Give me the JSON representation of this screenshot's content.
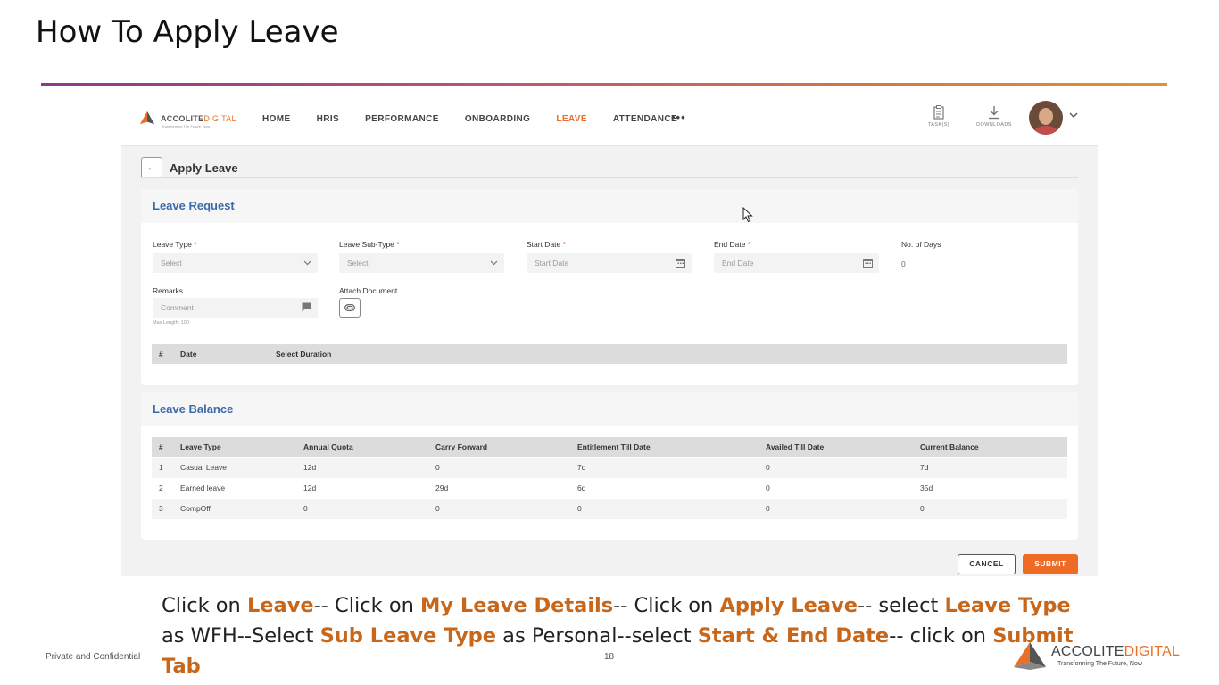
{
  "slide": {
    "title": "How To Apply Leave",
    "footer_left": "Private and Confidential",
    "page_number": "18"
  },
  "app": {
    "logo": {
      "name_left": "ACCOLITE",
      "name_right": "DIGITAL",
      "tagline": "Transforming The Future, Now"
    },
    "nav": [
      {
        "label": "HOME"
      },
      {
        "label": "HRIS"
      },
      {
        "label": "PERFORMANCE"
      },
      {
        "label": "ONBOARDING"
      },
      {
        "label": "LEAVE",
        "active": true
      },
      {
        "label": "ATTENDANCE"
      }
    ],
    "nav_more": "•••",
    "tools": {
      "tasks_label": "TASK(S)",
      "downloads_label": "DOWNLOADS"
    },
    "page_title": "Apply Leave",
    "leave_request": {
      "heading": "Leave Request",
      "leave_type": {
        "label": "Leave Type",
        "required": "*",
        "placeholder": "Select"
      },
      "leave_sub_type": {
        "label": "Leave Sub-Type",
        "required": "*",
        "placeholder": "Select"
      },
      "start_date": {
        "label": "Start Date",
        "required": "*",
        "placeholder": "Start Date"
      },
      "end_date": {
        "label": "End Date",
        "required": "*",
        "placeholder": "End Date"
      },
      "no_of_days": {
        "label": "No. of Days",
        "value": "0"
      },
      "remarks": {
        "label": "Remarks",
        "placeholder": "Comment",
        "hint": "Max Length: 100"
      },
      "attach": {
        "label": "Attach Document"
      },
      "table_headers": {
        "num": "#",
        "date": "Date",
        "duration": "Select Duration"
      }
    },
    "leave_balance": {
      "heading": "Leave Balance",
      "headers": [
        "#",
        "Leave Type",
        "Annual Quota",
        "Carry Forward",
        "Entitlement Till Date",
        "Availed Till Date",
        "Current Balance"
      ],
      "rows": [
        [
          "1",
          "Casual Leave",
          "12d",
          "0",
          "7d",
          "0",
          "7d"
        ],
        [
          "2",
          "Earned leave",
          "12d",
          "29d",
          "6d",
          "0",
          "35d"
        ],
        [
          "3",
          "CompOff",
          "0",
          "0",
          "0",
          "0",
          "0"
        ]
      ]
    },
    "buttons": {
      "cancel": "CANCEL",
      "submit": "SUBMIT"
    }
  },
  "instructions": {
    "p1": "Click on ",
    "h1": "Leave",
    "p2": "-- Click on ",
    "h2": "My Leave Details",
    "p3": "-- Click on ",
    "h3": "Apply Leave",
    "p4": "-- select ",
    "h4": "Leave Type",
    "p5": " as WFH--Select ",
    "h5": "Sub Leave Type",
    "p6": " as Personal--select ",
    "h6": "Start & End Date",
    "p7": "-- click on ",
    "h7": "Submit Tab"
  },
  "brand": {
    "name_left": "ACCOLITE",
    "name_right": "DIGITAL",
    "tagline": "Transforming The Future, Now"
  },
  "colors": {
    "accent": "#e8702a",
    "heading_blue": "#3b6aa8",
    "submit": "#ee6b26"
  }
}
